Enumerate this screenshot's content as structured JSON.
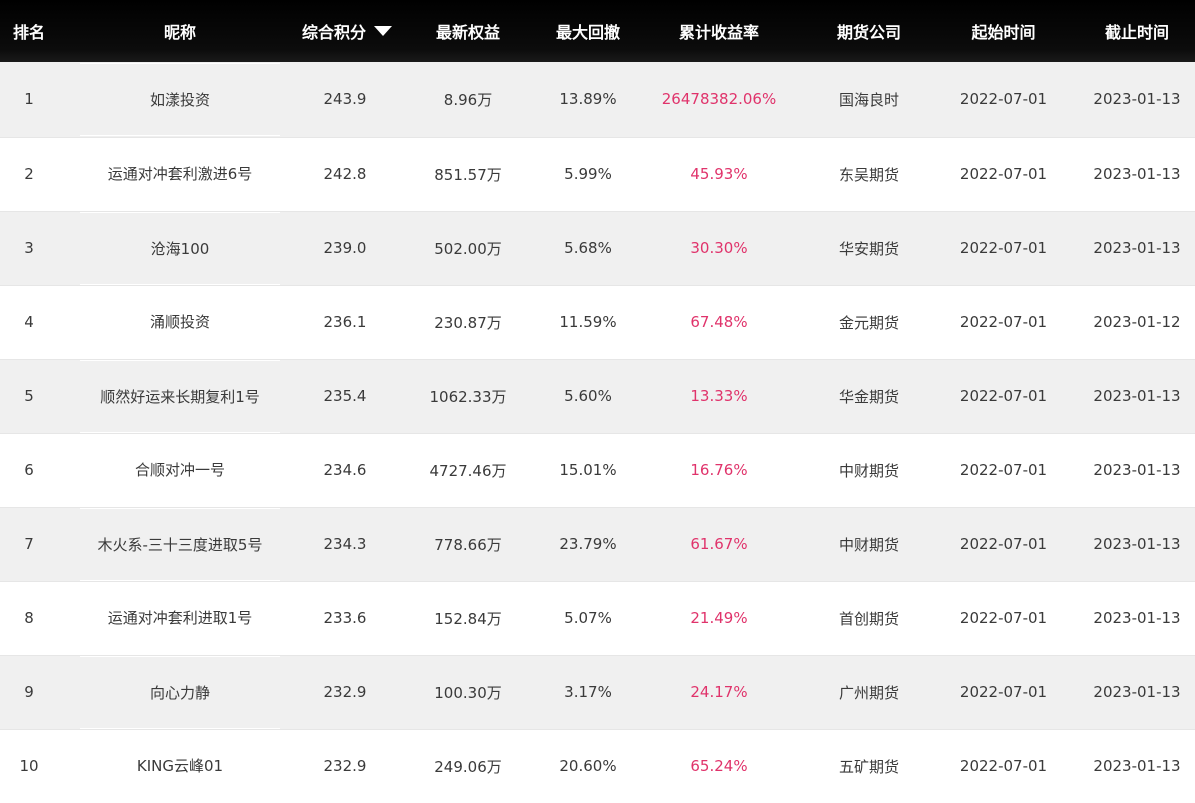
{
  "columns": {
    "rank": "排名",
    "nickname": "昵称",
    "score": "综合积分",
    "equity": "最新权益",
    "drawdown": "最大回撤",
    "return": "累计收益率",
    "company": "期货公司",
    "start": "起始时间",
    "end": "截止时间"
  },
  "sort_icon": "triangle-down-icon",
  "colors": {
    "header_bg": "#000000",
    "header_text": "#ffffff",
    "return_text": "#e0336b",
    "odd_row_bg": "#f0f0f0",
    "even_row_bg": "#ffffff"
  },
  "rows": [
    {
      "rank": "1",
      "nickname": "如漾投资",
      "score": "243.9",
      "equity": "8.96万",
      "drawdown": "13.89%",
      "return": "26478382.06%",
      "company": "国海良时",
      "start": "2022-07-01",
      "end": "2023-01-13"
    },
    {
      "rank": "2",
      "nickname": "运通对冲套利激进6号",
      "score": "242.8",
      "equity": "851.57万",
      "drawdown": "5.99%",
      "return": "45.93%",
      "company": "东吴期货",
      "start": "2022-07-01",
      "end": "2023-01-13"
    },
    {
      "rank": "3",
      "nickname": "沧海100",
      "score": "239.0",
      "equity": "502.00万",
      "drawdown": "5.68%",
      "return": "30.30%",
      "company": "华安期货",
      "start": "2022-07-01",
      "end": "2023-01-13"
    },
    {
      "rank": "4",
      "nickname": "涌顺投资",
      "score": "236.1",
      "equity": "230.87万",
      "drawdown": "11.59%",
      "return": "67.48%",
      "company": "金元期货",
      "start": "2022-07-01",
      "end": "2023-01-12"
    },
    {
      "rank": "5",
      "nickname": "顺然好运来长期复利1号",
      "score": "235.4",
      "equity": "1062.33万",
      "drawdown": "5.60%",
      "return": "13.33%",
      "company": "华金期货",
      "start": "2022-07-01",
      "end": "2023-01-13"
    },
    {
      "rank": "6",
      "nickname": "合顺对冲一号",
      "score": "234.6",
      "equity": "4727.46万",
      "drawdown": "15.01%",
      "return": "16.76%",
      "company": "中财期货",
      "start": "2022-07-01",
      "end": "2023-01-13"
    },
    {
      "rank": "7",
      "nickname": "木火系-三十三度进取5号",
      "score": "234.3",
      "equity": "778.66万",
      "drawdown": "23.79%",
      "return": "61.67%",
      "company": "中财期货",
      "start": "2022-07-01",
      "end": "2023-01-13"
    },
    {
      "rank": "8",
      "nickname": "运通对冲套利进取1号",
      "score": "233.6",
      "equity": "152.84万",
      "drawdown": "5.07%",
      "return": "21.49%",
      "company": "首创期货",
      "start": "2022-07-01",
      "end": "2023-01-13"
    },
    {
      "rank": "9",
      "nickname": "向心力静",
      "score": "232.9",
      "equity": "100.30万",
      "drawdown": "3.17%",
      "return": "24.17%",
      "company": "广州期货",
      "start": "2022-07-01",
      "end": "2023-01-13"
    },
    {
      "rank": "10",
      "nickname": "KING云峰01",
      "score": "232.9",
      "equity": "249.06万",
      "drawdown": "20.60%",
      "return": "65.24%",
      "company": "五矿期货",
      "start": "2022-07-01",
      "end": "2023-01-13"
    }
  ]
}
